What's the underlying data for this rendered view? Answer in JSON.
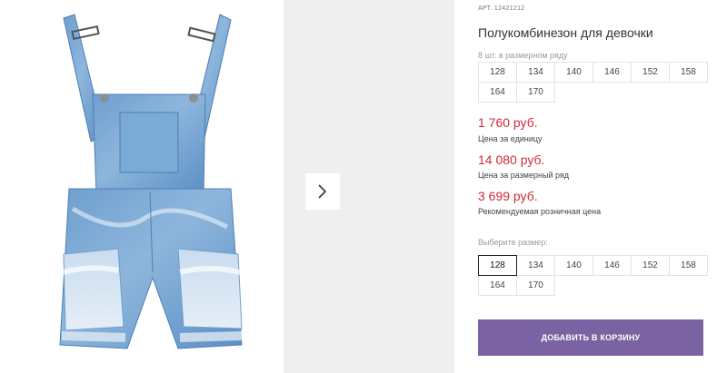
{
  "product": {
    "art_label": "АРТ.",
    "art_value": "12421212",
    "title": "Полукомбинезон для девочки",
    "pack_note": "8 шт. в размерном ряду"
  },
  "pack_sizes": [
    "128",
    "134",
    "140",
    "146",
    "152",
    "158",
    "164",
    "170"
  ],
  "prices": [
    {
      "value": "1 760 руб.",
      "label": "Цена за единицу"
    },
    {
      "value": "14 080 руб.",
      "label": "Цена за размерный ряд"
    },
    {
      "value": "3 699 руб.",
      "label": "Рекомендуемая розничная цена"
    }
  ],
  "size_select": {
    "label": "Выберите размер:",
    "options": [
      "128",
      "134",
      "140",
      "146",
      "152",
      "158",
      "164",
      "170"
    ],
    "selected": "128"
  },
  "cart_button": "ДОБАВИТЬ В КОРЗИНУ",
  "colors": {
    "price": "#d1293a",
    "accent_button": "#7b62a3",
    "photo_placeholder": "#efefef"
  },
  "icons": {
    "next": "chevron-right-icon"
  }
}
